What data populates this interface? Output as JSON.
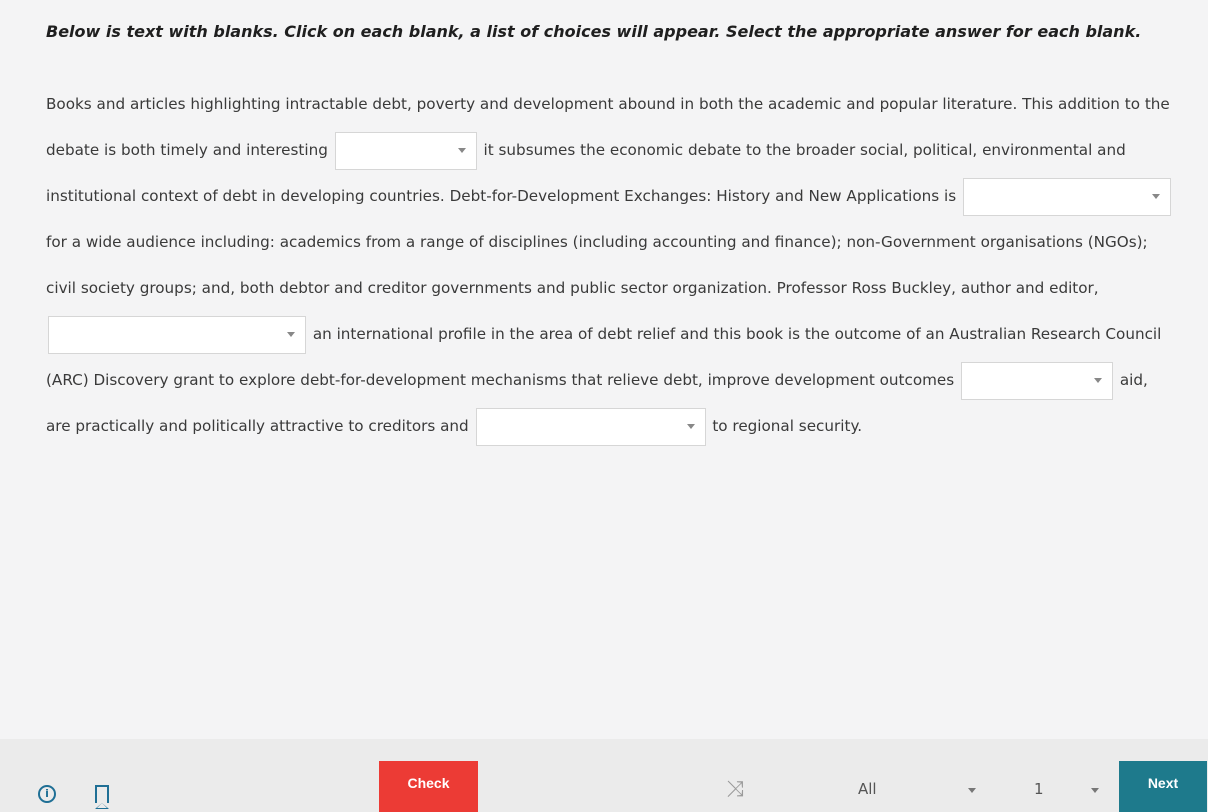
{
  "instructions": "Below is text with blanks. Click on each blank, a list of choices will appear. Select the appropriate answer for each blank.",
  "passage": {
    "seg1": "Books and articles highlighting intractable debt, poverty and development abound in both the academic and popular literature. This addition to the debate is both timely and interesting",
    "seg2": "it subsumes the economic debate to the broader social, political, environmental and institutional context of debt in developing countries. Debt-for-Development Exchanges: History and New Applications is",
    "seg3": "for a wide audience including: academics from a range of disciplines (including accounting and finance); non-Government organisations (NGOs); civil society groups; and, both debtor and creditor governments and public sector organization. Professor Ross Buckley, author and editor,",
    "seg4": "an international profile in the area of debt relief and this book is the outcome of an Australian Research Council (ARC) Discovery grant to explore debt-for-development mechanisms that relieve debt, improve development outcomes",
    "seg5": "aid, are practically and politically attractive to creditors and",
    "seg6": "to regional security."
  },
  "blanks": [
    "",
    "",
    "",
    "",
    ""
  ],
  "footer": {
    "info_icon": "info-circle-icon",
    "bookmark_icon": "bookmark-icon",
    "check_label": "Check",
    "shuffle_icon": "shuffle-icon",
    "filter_value": "All",
    "page_value": "1",
    "next_label": "Next"
  },
  "colors": {
    "check": "#ec3b35",
    "next": "#1e7a8c",
    "icon": "#1f6f95"
  }
}
